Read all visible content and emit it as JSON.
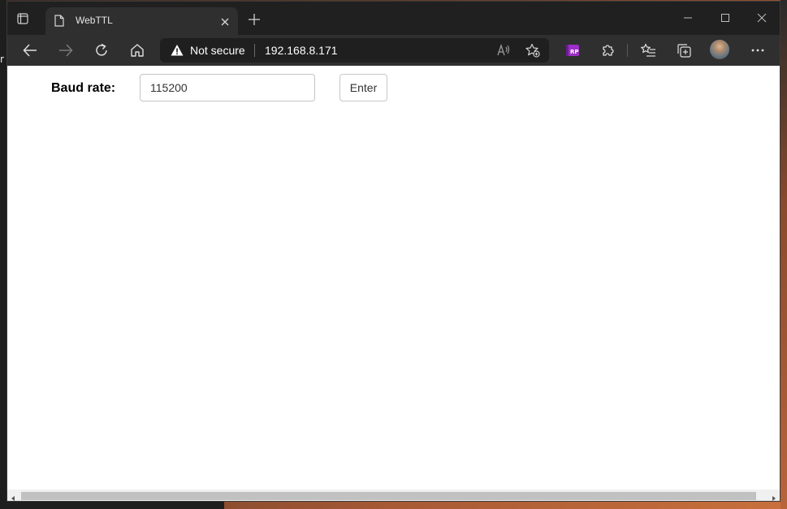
{
  "tab": {
    "title": "WebTTL"
  },
  "addressbar": {
    "security_label": "Not secure",
    "url": "192.168.8.171"
  },
  "extension": {
    "badge": "RP"
  },
  "page": {
    "baud_label": "Baud rate:",
    "baud_value": "115200",
    "enter_label": "Enter"
  },
  "desktop": {
    "left_edge_char": "r"
  },
  "colors": {
    "window_bg": "#202020",
    "toolbar_bg": "#2f2f2f",
    "extension_accent": "#9b2fc7"
  },
  "icons": {
    "tab_actions": "tab-actions-icon",
    "favicon": "page-icon",
    "close": "close-icon",
    "new_tab": "plus-icon",
    "back": "back-arrow-icon",
    "forward": "forward-arrow-icon",
    "refresh": "refresh-icon",
    "home": "home-icon",
    "warning": "warning-icon",
    "read_aloud": "read-aloud-icon",
    "add_favorite": "add-favorite-icon",
    "extensions": "puzzle-icon",
    "favorites": "favorites-icon",
    "collections": "collections-icon",
    "more": "more-icon"
  }
}
